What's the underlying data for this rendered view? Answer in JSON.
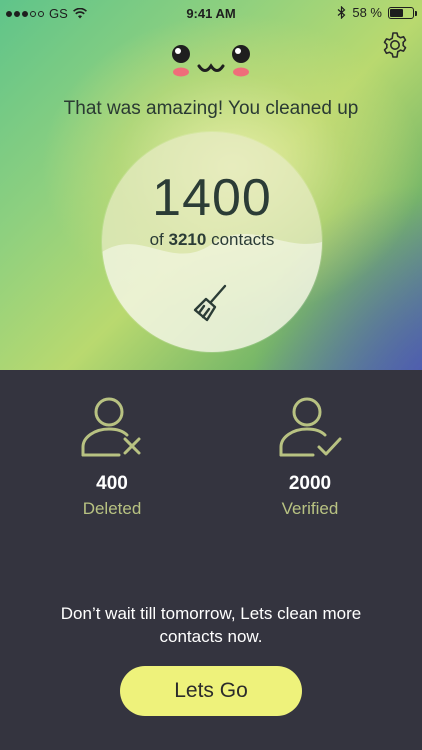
{
  "status_bar": {
    "carrier": "GS",
    "time": "9:41 AM",
    "battery_percent": "58 %",
    "battery_level": 0.58
  },
  "header": {
    "headline": "That was amazing! You cleaned up"
  },
  "summary": {
    "cleaned_count": "1400",
    "of_label": "of",
    "total_count": "3210",
    "contacts_label": "contacts"
  },
  "stats": {
    "deleted": {
      "value": "400",
      "label": "Deleted"
    },
    "verified": {
      "value": "2000",
      "label": "Verified"
    }
  },
  "cta": {
    "message": "Don’t wait till tomorrow, Lets clean more contacts now.",
    "button_label": "Lets Go"
  },
  "colors": {
    "accent": "#eef27b",
    "stat_icon": "#b8c282",
    "background_bottom": "#34343f"
  },
  "icons": {
    "settings": "gear-icon",
    "mascot": "kawaii-face-icon",
    "broom": "broom-icon",
    "deleted": "user-remove-icon",
    "verified": "user-check-icon"
  }
}
